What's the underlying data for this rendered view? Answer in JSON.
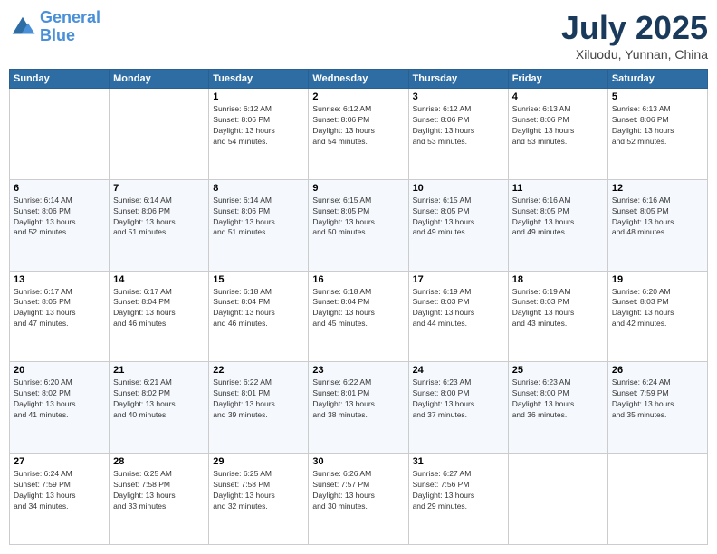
{
  "logo": {
    "line1": "General",
    "line2": "Blue"
  },
  "title": "July 2025",
  "subtitle": "Xiluodu, Yunnan, China",
  "weekdays": [
    "Sunday",
    "Monday",
    "Tuesday",
    "Wednesday",
    "Thursday",
    "Friday",
    "Saturday"
  ],
  "weeks": [
    [
      {
        "day": "",
        "detail": ""
      },
      {
        "day": "",
        "detail": ""
      },
      {
        "day": "1",
        "detail": "Sunrise: 6:12 AM\nSunset: 8:06 PM\nDaylight: 13 hours\nand 54 minutes."
      },
      {
        "day": "2",
        "detail": "Sunrise: 6:12 AM\nSunset: 8:06 PM\nDaylight: 13 hours\nand 54 minutes."
      },
      {
        "day": "3",
        "detail": "Sunrise: 6:12 AM\nSunset: 8:06 PM\nDaylight: 13 hours\nand 53 minutes."
      },
      {
        "day": "4",
        "detail": "Sunrise: 6:13 AM\nSunset: 8:06 PM\nDaylight: 13 hours\nand 53 minutes."
      },
      {
        "day": "5",
        "detail": "Sunrise: 6:13 AM\nSunset: 8:06 PM\nDaylight: 13 hours\nand 52 minutes."
      }
    ],
    [
      {
        "day": "6",
        "detail": "Sunrise: 6:14 AM\nSunset: 8:06 PM\nDaylight: 13 hours\nand 52 minutes."
      },
      {
        "day": "7",
        "detail": "Sunrise: 6:14 AM\nSunset: 8:06 PM\nDaylight: 13 hours\nand 51 minutes."
      },
      {
        "day": "8",
        "detail": "Sunrise: 6:14 AM\nSunset: 8:06 PM\nDaylight: 13 hours\nand 51 minutes."
      },
      {
        "day": "9",
        "detail": "Sunrise: 6:15 AM\nSunset: 8:05 PM\nDaylight: 13 hours\nand 50 minutes."
      },
      {
        "day": "10",
        "detail": "Sunrise: 6:15 AM\nSunset: 8:05 PM\nDaylight: 13 hours\nand 49 minutes."
      },
      {
        "day": "11",
        "detail": "Sunrise: 6:16 AM\nSunset: 8:05 PM\nDaylight: 13 hours\nand 49 minutes."
      },
      {
        "day": "12",
        "detail": "Sunrise: 6:16 AM\nSunset: 8:05 PM\nDaylight: 13 hours\nand 48 minutes."
      }
    ],
    [
      {
        "day": "13",
        "detail": "Sunrise: 6:17 AM\nSunset: 8:05 PM\nDaylight: 13 hours\nand 47 minutes."
      },
      {
        "day": "14",
        "detail": "Sunrise: 6:17 AM\nSunset: 8:04 PM\nDaylight: 13 hours\nand 46 minutes."
      },
      {
        "day": "15",
        "detail": "Sunrise: 6:18 AM\nSunset: 8:04 PM\nDaylight: 13 hours\nand 46 minutes."
      },
      {
        "day": "16",
        "detail": "Sunrise: 6:18 AM\nSunset: 8:04 PM\nDaylight: 13 hours\nand 45 minutes."
      },
      {
        "day": "17",
        "detail": "Sunrise: 6:19 AM\nSunset: 8:03 PM\nDaylight: 13 hours\nand 44 minutes."
      },
      {
        "day": "18",
        "detail": "Sunrise: 6:19 AM\nSunset: 8:03 PM\nDaylight: 13 hours\nand 43 minutes."
      },
      {
        "day": "19",
        "detail": "Sunrise: 6:20 AM\nSunset: 8:03 PM\nDaylight: 13 hours\nand 42 minutes."
      }
    ],
    [
      {
        "day": "20",
        "detail": "Sunrise: 6:20 AM\nSunset: 8:02 PM\nDaylight: 13 hours\nand 41 minutes."
      },
      {
        "day": "21",
        "detail": "Sunrise: 6:21 AM\nSunset: 8:02 PM\nDaylight: 13 hours\nand 40 minutes."
      },
      {
        "day": "22",
        "detail": "Sunrise: 6:22 AM\nSunset: 8:01 PM\nDaylight: 13 hours\nand 39 minutes."
      },
      {
        "day": "23",
        "detail": "Sunrise: 6:22 AM\nSunset: 8:01 PM\nDaylight: 13 hours\nand 38 minutes."
      },
      {
        "day": "24",
        "detail": "Sunrise: 6:23 AM\nSunset: 8:00 PM\nDaylight: 13 hours\nand 37 minutes."
      },
      {
        "day": "25",
        "detail": "Sunrise: 6:23 AM\nSunset: 8:00 PM\nDaylight: 13 hours\nand 36 minutes."
      },
      {
        "day": "26",
        "detail": "Sunrise: 6:24 AM\nSunset: 7:59 PM\nDaylight: 13 hours\nand 35 minutes."
      }
    ],
    [
      {
        "day": "27",
        "detail": "Sunrise: 6:24 AM\nSunset: 7:59 PM\nDaylight: 13 hours\nand 34 minutes."
      },
      {
        "day": "28",
        "detail": "Sunrise: 6:25 AM\nSunset: 7:58 PM\nDaylight: 13 hours\nand 33 minutes."
      },
      {
        "day": "29",
        "detail": "Sunrise: 6:25 AM\nSunset: 7:58 PM\nDaylight: 13 hours\nand 32 minutes."
      },
      {
        "day": "30",
        "detail": "Sunrise: 6:26 AM\nSunset: 7:57 PM\nDaylight: 13 hours\nand 30 minutes."
      },
      {
        "day": "31",
        "detail": "Sunrise: 6:27 AM\nSunset: 7:56 PM\nDaylight: 13 hours\nand 29 minutes."
      },
      {
        "day": "",
        "detail": ""
      },
      {
        "day": "",
        "detail": ""
      }
    ]
  ]
}
